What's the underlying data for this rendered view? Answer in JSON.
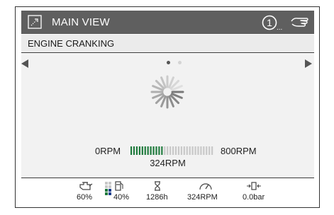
{
  "header": {
    "title": "MAIN VIEW",
    "alarm_count": "1",
    "alarm_ellipsis": "..."
  },
  "subheader": {
    "text": "ENGINE CRANKING"
  },
  "carousel": {
    "page_count": 2,
    "active_page": 1
  },
  "rpm": {
    "min_label": "0RPM",
    "max_label": "800RPM",
    "current_label": "324RPM",
    "min": 0,
    "max": 800,
    "current": 324,
    "bar_fraction": 0.4
  },
  "status": {
    "load_pct": "60%",
    "fuel_pct": "40%",
    "hours": "1286h",
    "rpm": "324RPM",
    "pressure": "0.0bar"
  },
  "colors": {
    "titlebar": "#5f5f5f",
    "bar_active": "#1e7a3c",
    "bar_inactive": "#c8c8c8",
    "fuel_indicator": "#1a3e8c"
  }
}
